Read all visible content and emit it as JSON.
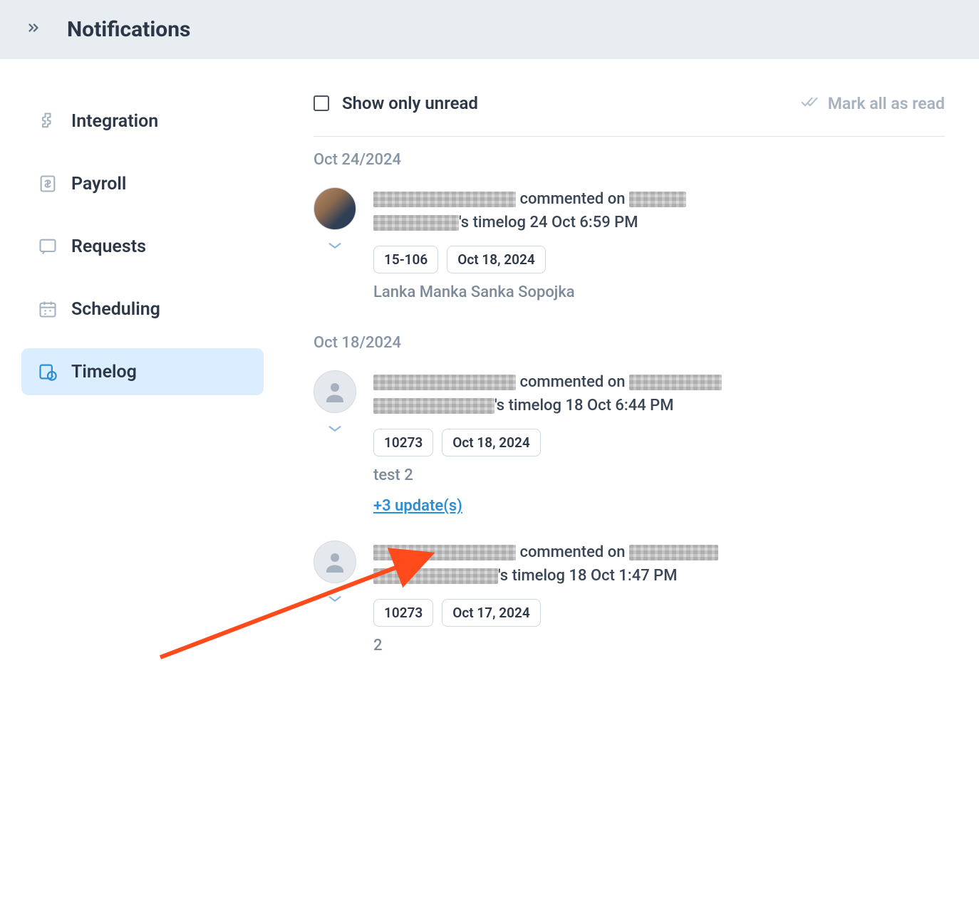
{
  "header": {
    "title": "Notifications"
  },
  "sidebar": {
    "items": [
      {
        "label": "Integration",
        "icon": "integration-icon"
      },
      {
        "label": "Payroll",
        "icon": "payroll-icon"
      },
      {
        "label": "Requests",
        "icon": "requests-icon"
      },
      {
        "label": "Scheduling",
        "icon": "scheduling-icon"
      },
      {
        "label": "Timelog",
        "icon": "timelog-icon",
        "active": true
      }
    ]
  },
  "toolbar": {
    "show_unread_label": "Show only unread",
    "mark_all_label": "Mark all as read"
  },
  "groups": [
    {
      "date": "Oct 24/2024",
      "items": [
        {
          "avatar": "photo",
          "action_mid": " commented on ",
          "suffix": "'s timelog ",
          "timestamp": "24 Oct 6:59 PM",
          "pill1": "15-106",
          "pill2": "Oct 18, 2024",
          "comment": "Lanka Manka Sanka Sopojka",
          "updates": ""
        }
      ]
    },
    {
      "date": "Oct 18/2024",
      "items": [
        {
          "avatar": "placeholder",
          "action_mid": " commented on ",
          "suffix": "'s timelog ",
          "timestamp": "18 Oct 6:44 PM",
          "pill1": "10273",
          "pill2": "Oct 18, 2024",
          "comment": "test 2",
          "updates": "+3 update(s)"
        },
        {
          "avatar": "placeholder",
          "action_mid": " commented on ",
          "suffix": "'s timelog ",
          "timestamp": "18 Oct 1:47 PM",
          "pill1": "10273",
          "pill2": "Oct 17, 2024",
          "comment": "2",
          "updates": ""
        }
      ]
    }
  ]
}
